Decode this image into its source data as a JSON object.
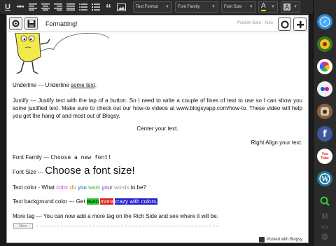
{
  "toolbar": {
    "underline_label": "U",
    "strike_label": "ABC",
    "quote_label": "“",
    "text_format": "Text Format",
    "font_family": "Font Family",
    "font_size": "Font Size",
    "font_color_label": "A",
    "bg_color_label": "A"
  },
  "header": {
    "title": "Formatting!",
    "publish": "Publish Date : Auto"
  },
  "content": {
    "underline_prefix": "Underline --- Underline ",
    "underline_word": "some text",
    "underline_suffix": ".",
    "justify": "Justify --- Justify text with the tap of a button. So I need to write a couple of lines of text to use so I can show you some justified text. Make sure to check out our how-to videos at www.blogsyapp.com/how-to. These video will help you get the hang of and most out of Blogsy.",
    "center": "Center your text.",
    "right": "Right Align your text.",
    "font_family_prefix": "Font Family --- ",
    "font_family_sample": "Choose a new font!",
    "font_size_prefix": "Font Size --- ",
    "font_size_sample": "Choose a font size!",
    "text_color_prefix": "Text color - What ",
    "text_color_words": [
      "color",
      "do",
      "you",
      "want",
      "your",
      "words"
    ],
    "text_color_suffix": " to be?",
    "bg_prefix": "Text background color --- Get ",
    "bg_words": [
      "even",
      "more",
      "crazy with colors."
    ],
    "more_tag": "More tag --- You can now add a more tag on the Rich Side and see where it will be.",
    "more_button": "More",
    "posted": "Posted with Blogsy"
  },
  "colors": {
    "text_colors": [
      "#e040e0",
      "#e08020",
      "#2255dd",
      "#30c030",
      "#8030c0",
      "#999999"
    ],
    "bg_colors": [
      "#22cc22",
      "#dd2020",
      "#2020cc"
    ]
  },
  "sidebar": {
    "icons": [
      "safari-icon",
      "sunflower-icon",
      "picasa-icon",
      "flickr-icon",
      "instagram-icon",
      "facebook-icon",
      "youtube-icon",
      "wordpress-icon",
      "search-icon",
      "m-icon",
      "code-icon",
      "settings-icon"
    ],
    "youtube_label": "You Tube"
  }
}
